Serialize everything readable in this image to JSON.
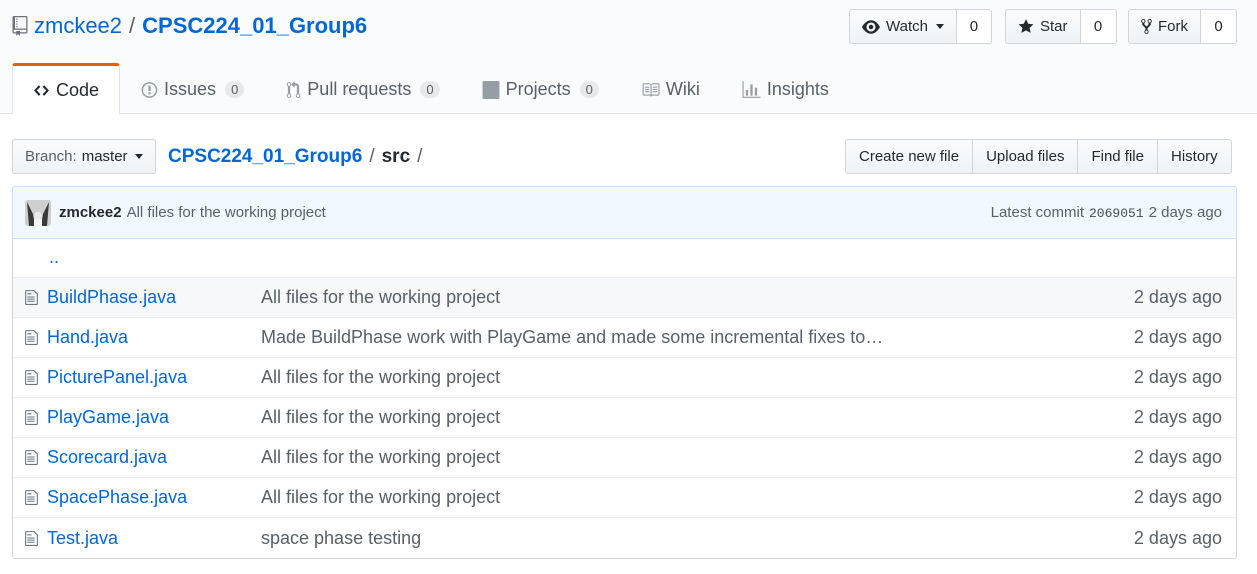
{
  "repo": {
    "owner": "zmckee2",
    "name": "CPSC224_01_Group6"
  },
  "social": {
    "watch_label": "Watch",
    "watch_count": "0",
    "star_label": "Star",
    "star_count": "0",
    "fork_label": "Fork",
    "fork_count": "0"
  },
  "tabs": [
    {
      "label": "Code",
      "icon": "code-icon"
    },
    {
      "label": "Issues",
      "count": "0",
      "icon": "issue-icon"
    },
    {
      "label": "Pull requests",
      "count": "0",
      "icon": "pull-request-icon"
    },
    {
      "label": "Projects",
      "count": "0",
      "icon": "project-icon"
    },
    {
      "label": "Wiki",
      "icon": "book-icon"
    },
    {
      "label": "Insights",
      "icon": "graph-icon"
    }
  ],
  "branch": {
    "label": "Branch:",
    "value": "master"
  },
  "breadcrumb": {
    "repo": "CPSC224_01_Group6",
    "sep1": "/",
    "dir": "src",
    "sep2": "/"
  },
  "actions": {
    "create": "Create new file",
    "upload": "Upload files",
    "find": "Find file",
    "history": "History"
  },
  "commit": {
    "author": "zmckee2",
    "message": "All files for the working project",
    "latest_label": "Latest commit",
    "sha": "2069051",
    "age": "2 days ago"
  },
  "up_dir": "..",
  "files": [
    {
      "name": "BuildPhase.java",
      "message": "All files for the working project",
      "age": "2 days ago"
    },
    {
      "name": "Hand.java",
      "message": "Made BuildPhase work with PlayGame and made some incremental fixes to…",
      "age": "2 days ago"
    },
    {
      "name": "PicturePanel.java",
      "message": "All files for the working project",
      "age": "2 days ago"
    },
    {
      "name": "PlayGame.java",
      "message": "All files for the working project",
      "age": "2 days ago"
    },
    {
      "name": "Scorecard.java",
      "message": "All files for the working project",
      "age": "2 days ago"
    },
    {
      "name": "SpacePhase.java",
      "message": "All files for the working project",
      "age": "2 days ago"
    },
    {
      "name": "Test.java",
      "message": "space phase testing",
      "age": "2 days ago"
    }
  ],
  "colors": {
    "link": "#0366d6",
    "tab_accent": "#e36209",
    "commit_bg": "#f1f8ff",
    "muted": "#586069"
  }
}
